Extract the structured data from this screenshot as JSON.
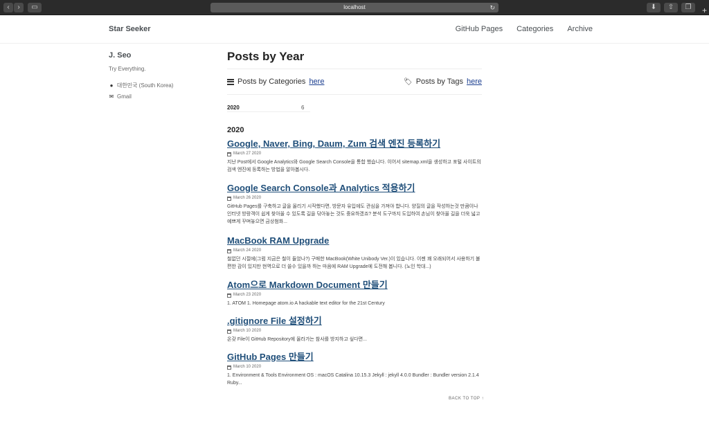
{
  "browser": {
    "url": "localhost"
  },
  "masthead": {
    "title": "Star Seeker",
    "nav": [
      "GitHub Pages",
      "Categories",
      "Archive"
    ]
  },
  "author": {
    "name": "J. Seo",
    "bio": "Try Everything.",
    "location": "대한민국 (South Korea)",
    "email": "Gmail"
  },
  "page": {
    "title": "Posts by Year",
    "by_categories_prefix": "Posts by Categories",
    "by_categories_link": "here",
    "by_tags_prefix": "Posts by Tags",
    "by_tags_link": "here",
    "year_index": {
      "year": "2020",
      "count": "6"
    },
    "year_heading": "2020",
    "back_to_top": "BACK TO TOP ↑"
  },
  "posts": [
    {
      "title": "Google, Naver, Bing, Daum, Zum 검색 엔진 등록하기",
      "date": "March 27 2020",
      "excerpt": "지난 Post에서 Google Analytics와 Google Search Console을 통합 했습니다. 이어서 sitemap.xml을 생성하고 포털 사이트의 검색 엔진에 등록하는 방법을 알아봅시다."
    },
    {
      "title": "Google Search Console과 Analytics 적용하기",
      "date": "March 26 2020",
      "excerpt": "GitHub Pages를 구축하고 글을 올리기 시작했다면, 방문자 유입에도 관심을 가져야 합니다. 양질의 글을 작성하는것 만큼이나 인터넷 방랑객이 쉽게 찾아올 수 있도록 길을 닦아놓는 것도 중요하겠죠? 분석 도구까지 도입하여 손님이 찾아올 길을 더욱 넓고 예쁘게 꾸며놓으면 금상첨화..."
    },
    {
      "title": "MacBook RAM Upgrade",
      "date": "March 24 2020",
      "excerpt": "철없던 시절에(그럼 지금은 철이 들었나?) 구매한 MacBook(White Unibody Ver.)이 있습니다. 이젠 꽤 오래되어서 사용하기 불편한 감이 있지만 현역으로 더 쓸수 있을까 하는 마음에 RAM Upgrade에 도전해 봅니다. (노인 학대...)"
    },
    {
      "title": "Atom으로 Markdown Document 만들기",
      "date": "March 23 2020",
      "excerpt": "1. ATOM 1. Homepage atom.io A hackable text editor for the 21st Century"
    },
    {
      "title": ".gitignore File 설정하기",
      "date": "March 10 2020",
      "excerpt": "온갖 File이 GitHub Repository에 올라가는 참사를 방지하고 싶다면..."
    },
    {
      "title": "GitHub Pages 만들기",
      "date": "March 10 2020",
      "excerpt": "1. Environment & Tools Environment OS : macOS Catalina 10.15.3 Jekyll : jekyll 4.0.0 Bundler : Bundler version 2.1.4 Ruby..."
    }
  ]
}
